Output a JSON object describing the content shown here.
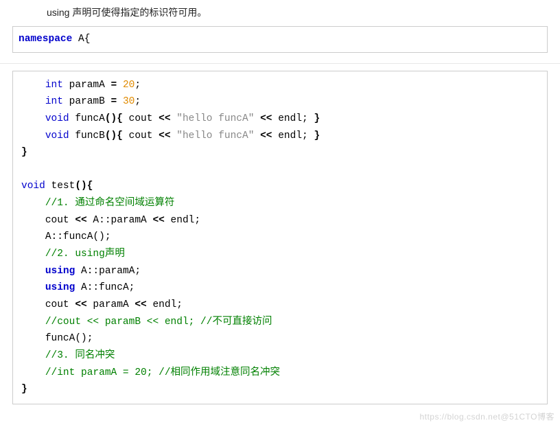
{
  "intro": "using 声明可使得指定的标识符可用。",
  "block1": {
    "l1_kw": "namespace",
    "l1_rest": " A{"
  },
  "block2": {
    "l1": {
      "indent": "    ",
      "type": "int",
      "name": " paramA ",
      "eq": "=",
      "sp": " ",
      "num": "20",
      "end": ";"
    },
    "l2": {
      "indent": "    ",
      "type": "int",
      "name": " paramB ",
      "eq": "=",
      "sp": " ",
      "num": "30",
      "end": ";"
    },
    "l3": {
      "indent": "    ",
      "type": "void",
      "name": " funcA",
      "sig": "(){",
      "mid1": " cout ",
      "op1": "<<",
      "sp1": " ",
      "str": "\"hello funcA\"",
      "sp2": " ",
      "op2": "<<",
      "mid2": " endl; ",
      "close": "}"
    },
    "l4": {
      "indent": "    ",
      "type": "void",
      "name": " funcB",
      "sig": "(){",
      "mid1": " cout ",
      "op1": "<<",
      "sp1": " ",
      "str": "\"hello funcA\"",
      "sp2": " ",
      "op2": "<<",
      "mid2": " endl; ",
      "close": "}"
    },
    "l5": "}",
    "l6": "",
    "l7": {
      "type": "void",
      "name": " test",
      "sig": "(){"
    },
    "l8": {
      "indent": "    ",
      "cmt": "//1. 通过命名空间域运算符"
    },
    "l9": {
      "indent": "    ",
      "a": "cout ",
      "op1": "<<",
      "b": " A::paramA ",
      "op2": "<<",
      "c": " endl;"
    },
    "l10": {
      "indent": "    ",
      "text": "A::funcA();"
    },
    "l11": {
      "indent": "    ",
      "cmt": "//2. using声明"
    },
    "l12": {
      "indent": "    ",
      "kw": "using",
      "rest": " A::paramA;"
    },
    "l13": {
      "indent": "    ",
      "kw": "using",
      "rest": " A::funcA;"
    },
    "l14": {
      "indent": "    ",
      "a": "cout ",
      "op1": "<<",
      "b": " paramA ",
      "op2": "<<",
      "c": " endl;"
    },
    "l15": {
      "indent": "    ",
      "cmt": "//cout << paramB << endl; //不可直接访问"
    },
    "l16": {
      "indent": "    ",
      "text": "funcA();"
    },
    "l17": {
      "indent": "    ",
      "cmt": "//3. 同名冲突"
    },
    "l18": {
      "indent": "    ",
      "cmt": "//int paramA = 20; //相同作用域注意同名冲突"
    },
    "l19": "}"
  },
  "watermark": "https://blog.csdn.net@51CTO博客"
}
